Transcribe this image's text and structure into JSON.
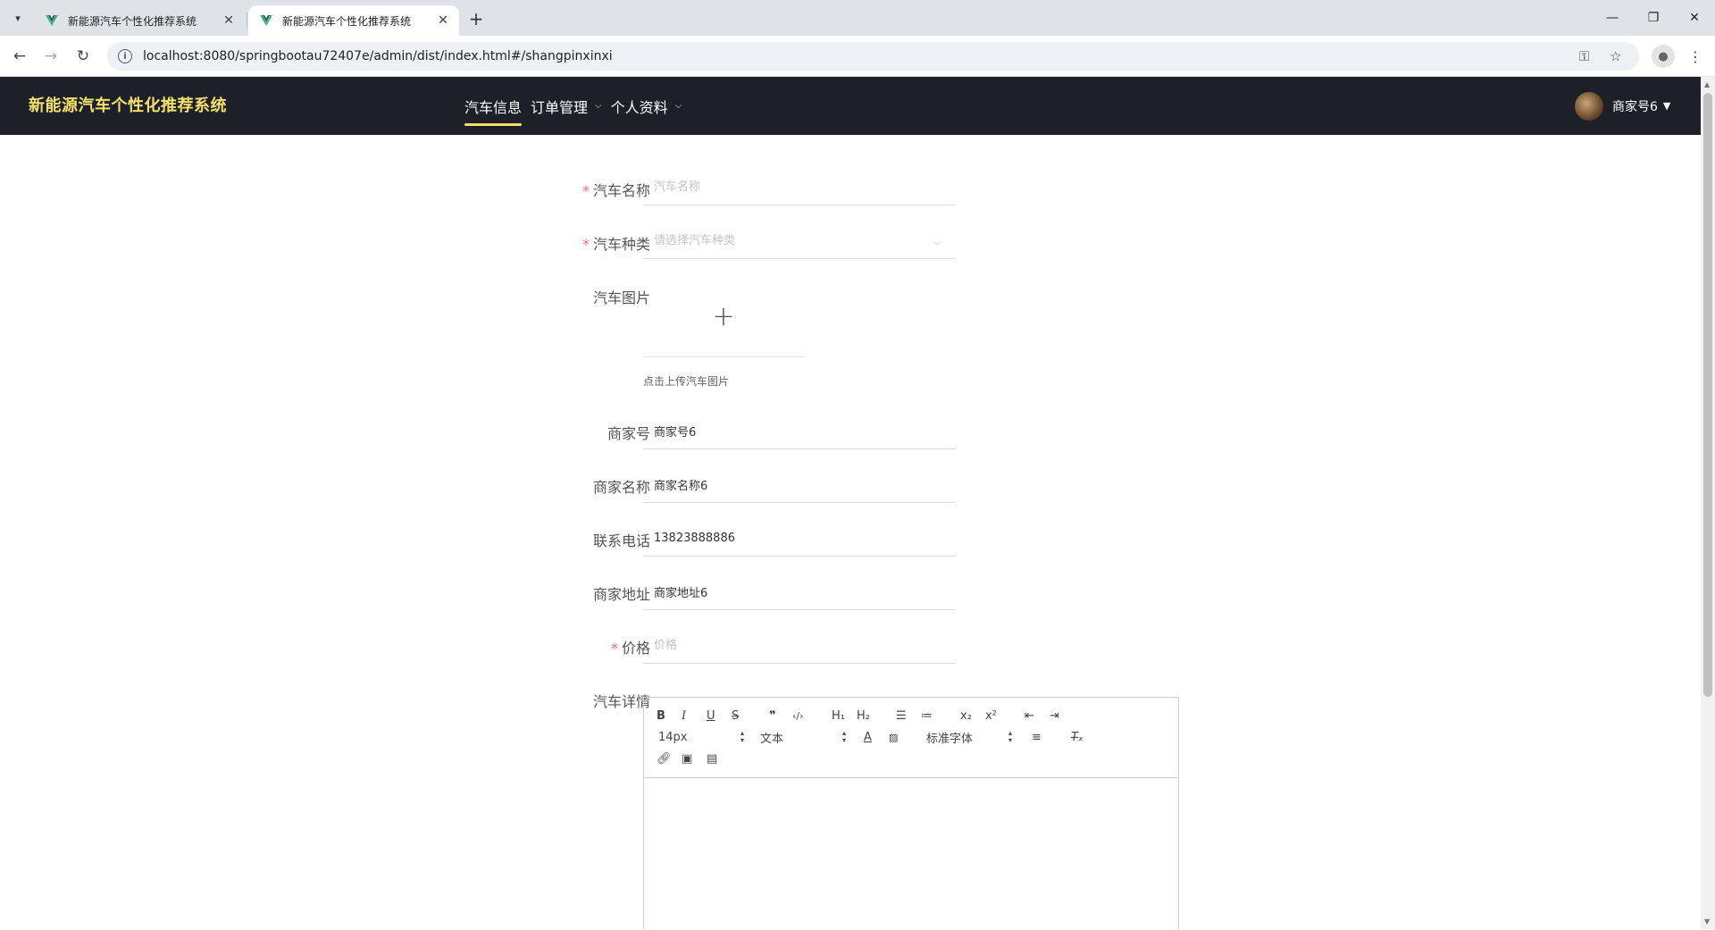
{
  "browser": {
    "tabs": [
      {
        "title": "新能源汽车个性化推荐系统",
        "active": false
      },
      {
        "title": "新能源汽车个性化推荐系统",
        "active": true
      }
    ],
    "url": "localhost:8080/springbootau72407e/admin/dist/index.html#/shangpinxinxi"
  },
  "header": {
    "brand": "新能源汽车个性化推荐系统",
    "nav": [
      {
        "label": "汽车信息",
        "active": true,
        "has_dropdown": false
      },
      {
        "label": "订单管理",
        "active": false,
        "has_dropdown": true
      },
      {
        "label": "个人资料",
        "active": false,
        "has_dropdown": true
      }
    ],
    "user": "商家号6",
    "accent_color": "#f3e06a",
    "bg_color": "#1d2028"
  },
  "form": {
    "car_name": {
      "label": "汽车名称",
      "required": true,
      "value": "",
      "placeholder": "汽车名称"
    },
    "car_type": {
      "label": "汽车种类",
      "required": true,
      "value": "",
      "placeholder": "请选择汽车种类"
    },
    "car_image": {
      "label": "汽车图片",
      "tip": "点击上传汽车图片"
    },
    "merchant_no": {
      "label": "商家号",
      "value": "商家号6"
    },
    "merchant_name": {
      "label": "商家名称",
      "value": "商家名称6"
    },
    "phone": {
      "label": "联系电话",
      "value": "13823888886"
    },
    "merchant_address": {
      "label": "商家地址",
      "value": "商家地址6"
    },
    "price": {
      "label": "价格",
      "required": true,
      "value": "",
      "placeholder": "价格"
    },
    "car_detail": {
      "label": "汽车详情"
    }
  },
  "editor": {
    "font_size": "14px",
    "header_select": "文本",
    "font_family": "标准字体",
    "buttons": [
      "B",
      "I",
      "U",
      "S",
      "❞",
      "‹/›",
      "H₁",
      "H₂",
      "ordered-list",
      "bullet-list",
      "x₂",
      "x²",
      "outdent",
      "indent",
      "A",
      "background",
      "align",
      "clean",
      "link",
      "image",
      "video"
    ]
  },
  "required_color": "#f56c6c"
}
